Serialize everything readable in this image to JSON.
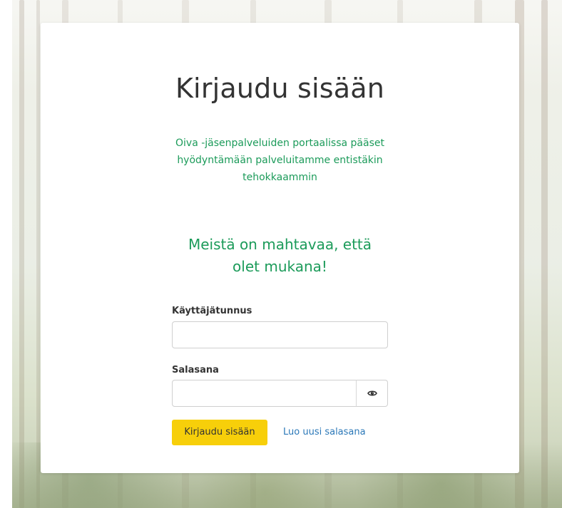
{
  "login": {
    "title": "Kirjaudu sisään",
    "intro": "Oiva -jäsenpalveluiden portaalissa pääset hyödyntämään palveluitamme entistäkin tehokkaammin",
    "welcome": "Meistä on mahtavaa, että olet mukana!",
    "username_label": "Käyttäjätunnus",
    "username_value": "",
    "password_label": "Salasana",
    "password_value": "",
    "show_password_icon": "eye-icon",
    "submit_label": "Kirjaudu sisään",
    "reset_link": "Luo uusi salasana"
  },
  "colors": {
    "accent_green": "#1c9b5a",
    "button_yellow": "#f7cf0a",
    "link_blue": "#2b78b8"
  }
}
